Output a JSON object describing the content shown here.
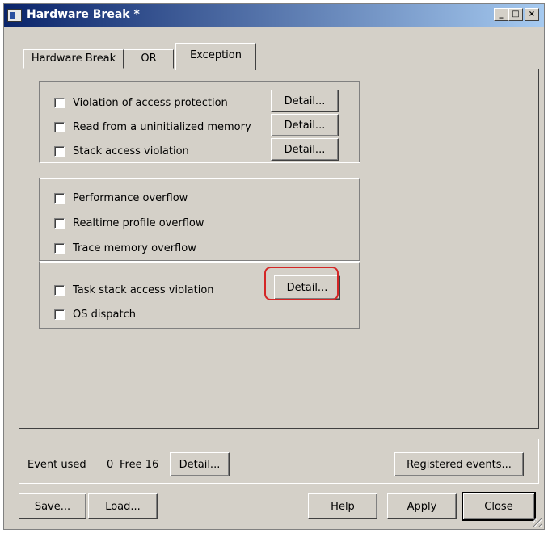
{
  "window": {
    "title": "Hardware Break *",
    "controls": {
      "minimize": "_",
      "maximize": "□",
      "close": "×"
    }
  },
  "tabs": [
    {
      "label": "Hardware Break"
    },
    {
      "label": "OR"
    },
    {
      "label": "Exception"
    }
  ],
  "group1": {
    "items": [
      {
        "label": "Violation of access protection",
        "detail": "Detail...",
        "checked": false
      },
      {
        "label": "Read from a uninitialized memory",
        "detail": "Detail...",
        "checked": false
      },
      {
        "label": "Stack access violation",
        "detail": "Detail...",
        "checked": false
      }
    ]
  },
  "group2": {
    "items": [
      {
        "label": "Performance overflow",
        "checked": false
      },
      {
        "label": "Realtime profile overflow",
        "checked": false
      },
      {
        "label": "Trace memory overflow",
        "checked": false
      }
    ]
  },
  "group3": {
    "items": [
      {
        "label": "Task stack access violation",
        "detail": "Detail...",
        "checked": false
      },
      {
        "label": "OS dispatch",
        "checked": false
      }
    ]
  },
  "status": {
    "event_used_label": "Event used",
    "event_used_value": "0",
    "free_label": "Free 16",
    "detail": "Detail...",
    "registered": "Registered events..."
  },
  "footer": {
    "save": "Save...",
    "load": "Load...",
    "help": "Help",
    "apply": "Apply",
    "close": "Close"
  },
  "colors": {
    "dialog_bg": "#d4d0c8",
    "title_gradient_start": "#0a246a",
    "title_gradient_end": "#a6caf0",
    "highlight": "#d42626"
  }
}
